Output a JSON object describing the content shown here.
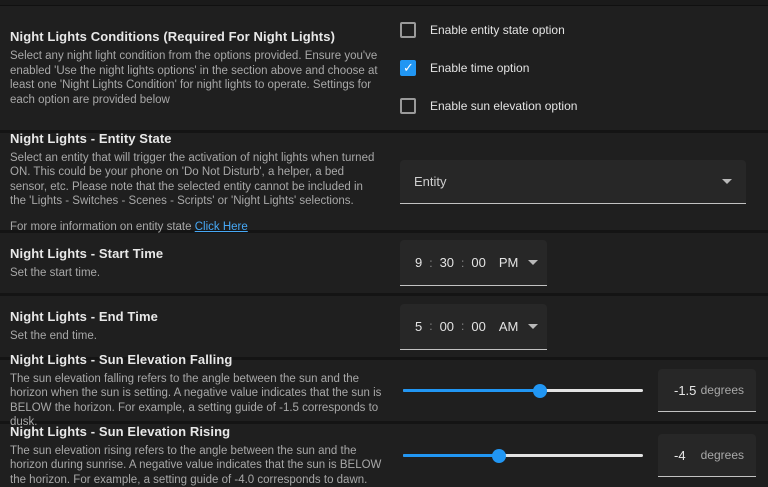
{
  "colors": {
    "accent": "#2196f3",
    "link": "#47a8f5",
    "section_bg": "#1f1f1f",
    "page_bg": "#141414"
  },
  "conditions": {
    "title": "Night Lights Conditions (Required For Night Lights)",
    "description": "Select any night light condition from the options provided. Ensure you've enabled 'Use the night lights options' in the section above and choose at least one 'Night Lights Condition' for night lights to operate. Settings for each option are provided below",
    "options": [
      {
        "label": "Enable entity state option",
        "checked": false
      },
      {
        "label": "Enable time option",
        "checked": true
      },
      {
        "label": "Enable sun elevation option",
        "checked": false
      }
    ]
  },
  "entity_state": {
    "title": "Night Lights - Entity State",
    "description": "Select an entity that will trigger the activation of night lights when turned ON. This could be your phone on 'Do Not Disturb', a helper, a bed sensor, etc. Please note that the selected entity cannot be included in the 'Lights - Switches - Scenes - Scripts' or 'Night Lights' selections.",
    "more_info_prefix": "For more information on entity state ",
    "more_info_link": "Click Here",
    "dropdown_label": "Entity"
  },
  "start_time": {
    "title": "Night Lights - Start Time",
    "description": "Set the start time.",
    "hours": "9",
    "minutes": "30",
    "seconds": "00",
    "meridiem": "PM",
    "colon": ":"
  },
  "end_time": {
    "title": "Night Lights - End Time",
    "description": "Set the end time.",
    "hours": "5",
    "minutes": "00",
    "seconds": "00",
    "meridiem": "AM",
    "colon": ":"
  },
  "sun_falling": {
    "title": "Night Lights - Sun Elevation Falling",
    "description": "The sun elevation falling refers to the angle between the sun and the horizon when the sun is setting. A negative value indicates that the sun is BELOW the horizon. For example, a setting guide of -1.5 corresponds to dusk.",
    "value": "-1.5",
    "unit": "degrees",
    "slider_percent": 57
  },
  "sun_rising": {
    "title": "Night Lights - Sun Elevation Rising",
    "description": "The sun elevation rising refers to the angle between the sun and the horizon during sunrise. A negative value indicates that the sun is BELOW the horizon. For example, a setting guide of -4.0 corresponds to dawn.",
    "value": "-4",
    "unit": "degrees",
    "slider_percent": 40
  }
}
